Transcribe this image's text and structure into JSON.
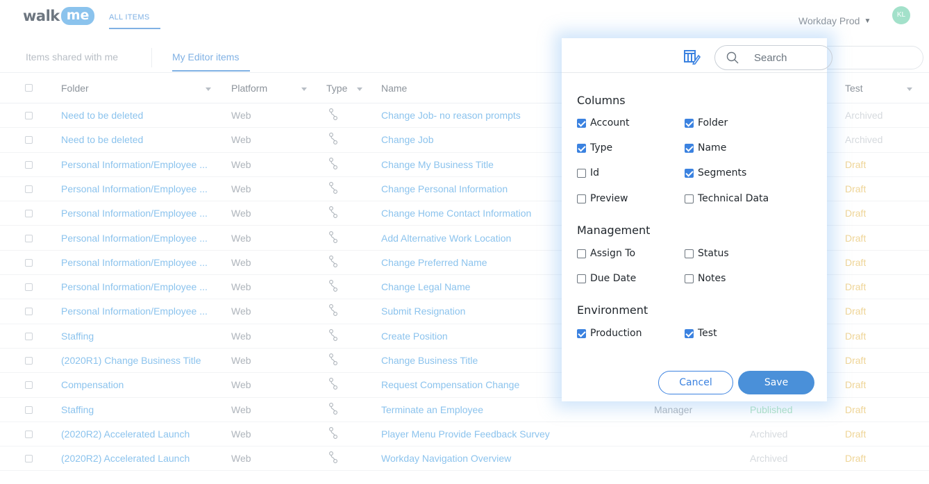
{
  "header": {
    "logo_walk": "walk",
    "logo_me": "me",
    "nav_all_items": "ALL ITEMS",
    "environment": "Workday Prod",
    "avatar_initials": "KL"
  },
  "tabs": {
    "shared": "Items shared with me",
    "editor": "My Editor items"
  },
  "table": {
    "headers": {
      "folder": "Folder",
      "platform": "Platform",
      "type": "Type",
      "name": "Name",
      "test": "Test"
    },
    "rows": [
      {
        "folder": "Need to be deleted",
        "platform": "Web",
        "name": "Change Job- no reason prompts",
        "assign": "",
        "prod": "",
        "test": "Archived"
      },
      {
        "folder": "Need to be deleted",
        "platform": "Web",
        "name": "Change Job",
        "assign": "",
        "prod": "",
        "test": "Archived"
      },
      {
        "folder": "Personal Information/Employee ...",
        "platform": "Web",
        "name": "Change My Business Title",
        "assign": "",
        "prod": "",
        "test": "Draft"
      },
      {
        "folder": "Personal Information/Employee ...",
        "platform": "Web",
        "name": "Change Personal Information",
        "assign": "",
        "prod": "",
        "test": "Draft"
      },
      {
        "folder": "Personal Information/Employee ...",
        "platform": "Web",
        "name": "Change Home Contact Information",
        "assign": "",
        "prod": "",
        "test": "Draft"
      },
      {
        "folder": "Personal Information/Employee ...",
        "platform": "Web",
        "name": "Add Alternative Work Location",
        "assign": "",
        "prod": "",
        "test": "Draft"
      },
      {
        "folder": "Personal Information/Employee ...",
        "platform": "Web",
        "name": "Change Preferred Name",
        "assign": "",
        "prod": "",
        "test": "Draft"
      },
      {
        "folder": "Personal Information/Employee ...",
        "platform": "Web",
        "name": "Change Legal Name",
        "assign": "",
        "prod": "",
        "test": "Draft"
      },
      {
        "folder": "Personal Information/Employee ...",
        "platform": "Web",
        "name": "Submit Resignation",
        "assign": "",
        "prod": "",
        "test": "Draft"
      },
      {
        "folder": "Staffing",
        "platform": "Web",
        "name": "Create Position",
        "assign": "",
        "prod": "",
        "test": "Draft"
      },
      {
        "folder": "(2020R1) Change Business Title",
        "platform": "Web",
        "name": "Change Business Title",
        "assign": "",
        "prod": "",
        "test": "Draft"
      },
      {
        "folder": "Compensation",
        "platform": "Web",
        "name": "Request Compensation Change",
        "assign": "",
        "prod": "",
        "test": "Draft"
      },
      {
        "folder": "Staffing",
        "platform": "Web",
        "name": "Terminate an Employee",
        "assign": "Manager",
        "prod": "Published",
        "test": "Draft"
      },
      {
        "folder": "(2020R2) Accelerated Launch",
        "platform": "Web",
        "name": "Player Menu Provide Feedback Survey",
        "assign": "",
        "prod": "Archived",
        "test": "Draft"
      },
      {
        "folder": "(2020R2) Accelerated Launch",
        "platform": "Web",
        "name": "Workday Navigation Overview",
        "assign": "",
        "prod": "Archived",
        "test": "Draft"
      }
    ]
  },
  "popup": {
    "search_placeholder": "Search",
    "columns_title": "Columns",
    "management_title": "Management",
    "environment_title": "Environment",
    "options": {
      "account": {
        "label": "Account",
        "checked": true
      },
      "folder": {
        "label": "Folder",
        "checked": true
      },
      "type": {
        "label": "Type",
        "checked": true
      },
      "name": {
        "label": "Name",
        "checked": true
      },
      "id": {
        "label": "Id",
        "checked": false
      },
      "segments": {
        "label": "Segments",
        "checked": true
      },
      "preview": {
        "label": "Preview",
        "checked": false
      },
      "technical": {
        "label": "Technical Data",
        "checked": false
      },
      "assign": {
        "label": "Assign To",
        "checked": false
      },
      "status": {
        "label": "Status",
        "checked": false
      },
      "due": {
        "label": "Due Date",
        "checked": false
      },
      "notes": {
        "label": "Notes",
        "checked": false
      },
      "production": {
        "label": "Production",
        "checked": true
      },
      "test": {
        "label": "Test",
        "checked": true
      }
    },
    "cancel_label": "Cancel",
    "save_label": "Save"
  },
  "colors": {
    "accent": "#4a90d9",
    "link": "#5aa9e6",
    "draft": "#e8c36a",
    "published": "#8fd7a8",
    "archived": "#c4cad0",
    "checkbox_checked": "#3b82e0"
  }
}
